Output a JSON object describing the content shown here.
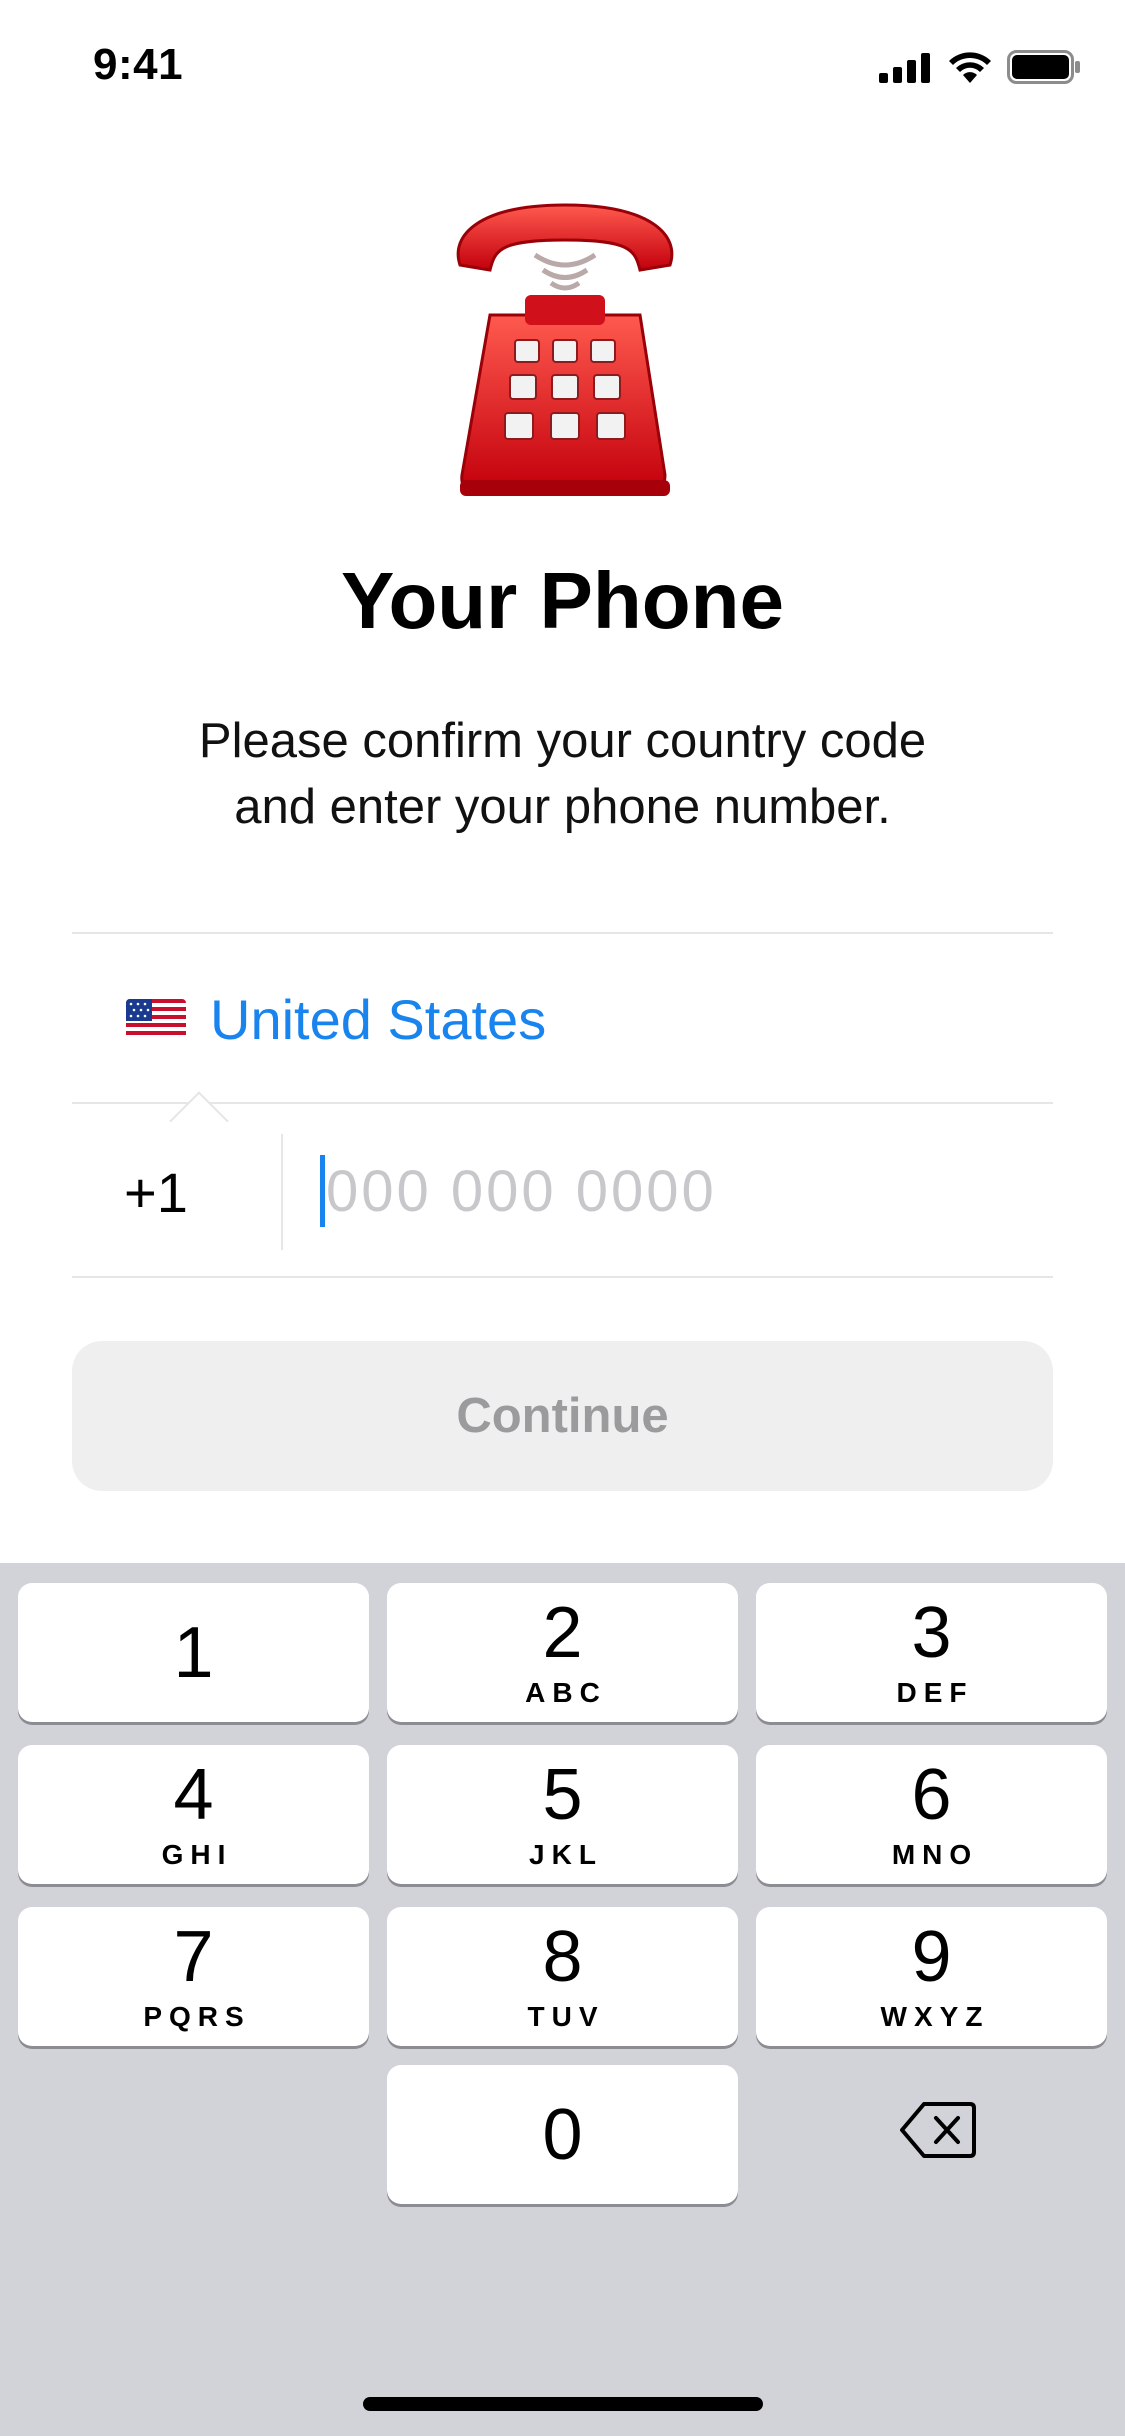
{
  "status_bar": {
    "time": "9:41"
  },
  "header": {
    "title": "Your Phone",
    "subtitle_line1": "Please confirm your country code",
    "subtitle_line2": "and enter your phone number."
  },
  "country": {
    "flag": "us-flag-icon",
    "name": "United States"
  },
  "phone": {
    "code": "+1",
    "placeholder": "000 000 0000",
    "value": ""
  },
  "continue_label": "Continue",
  "colors": {
    "accent": "#1a84ee",
    "keyboard_bg": "#d1d3d9",
    "button_bg": "#efeff0"
  },
  "keypad": {
    "k1": {
      "num": "1",
      "letters": ""
    },
    "k2": {
      "num": "2",
      "letters": "ABC"
    },
    "k3": {
      "num": "3",
      "letters": "DEF"
    },
    "k4": {
      "num": "4",
      "letters": "GHI"
    },
    "k5": {
      "num": "5",
      "letters": "JKL"
    },
    "k6": {
      "num": "6",
      "letters": "MNO"
    },
    "k7": {
      "num": "7",
      "letters": "PQRS"
    },
    "k8": {
      "num": "8",
      "letters": "TUV"
    },
    "k9": {
      "num": "9",
      "letters": "WXYZ"
    },
    "k0": {
      "num": "0",
      "letters": ""
    }
  }
}
